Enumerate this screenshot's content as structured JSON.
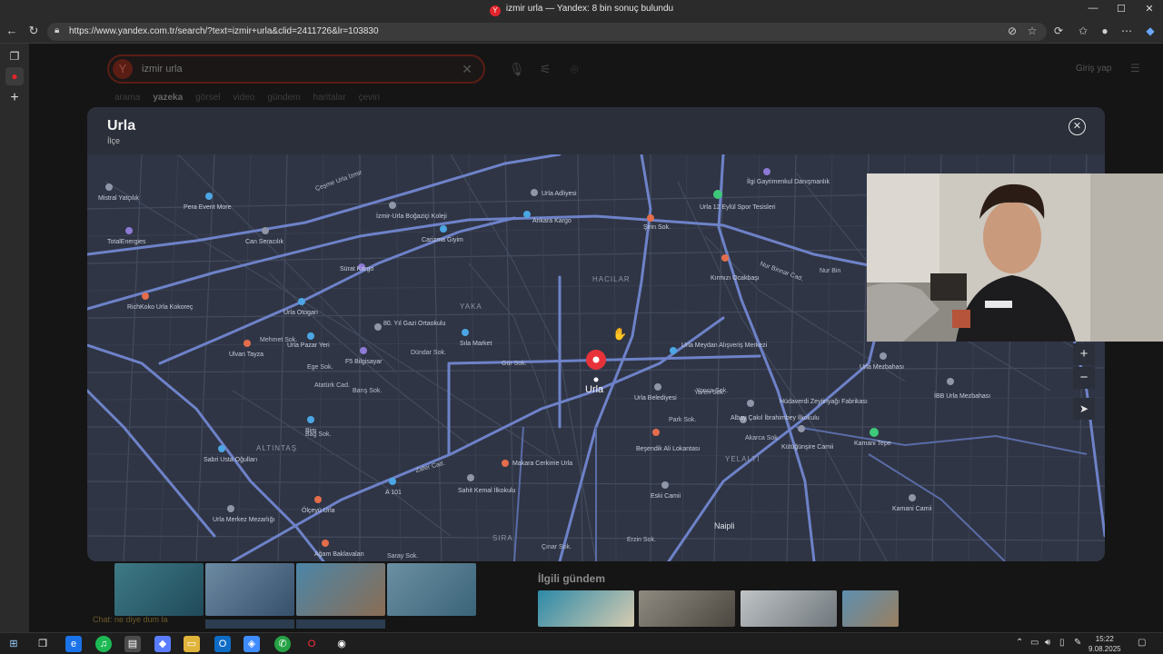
{
  "window": {
    "title": "izmir urla — Yandex: 8 bin sonuç bulundu",
    "minimize": "—",
    "maximize": "☐",
    "close": "✕"
  },
  "address_bar": {
    "url": "https://www.yandex.com.tr/search/?text=izmir+urla&clid=2411726&lr=103830"
  },
  "search": {
    "query": "izmir urla",
    "login_label": "Giriş yap",
    "tabs": [
      "arama",
      "yazeka",
      "görsel",
      "video",
      "gündem",
      "haritalar",
      "çeviri"
    ],
    "active_tab": "yazeka"
  },
  "modal": {
    "title": "Urla",
    "subtitle": "İlçe",
    "zoom_in": "+",
    "zoom_out": "−"
  },
  "map": {
    "center_label": "Urla",
    "districts": [
      "HACILAR",
      "YAKA",
      "ALTINTAŞ",
      "YELALTI",
      "SIRA"
    ],
    "roads": [
      "Çeşme Urla İzmir",
      "Nur Binnar Cad.",
      "Nur Bin",
      "Gür Sok.",
      "Zafer Cad.",
      "Atatürk Cad.",
      "Barış Sok.",
      "Dündar Sok.",
      "Ege Sok.",
      "Bağ Sok.",
      "Saray Sok.",
      "Çınar Sok.",
      "Yaren Sok.",
      "Park Sok.",
      "Erzin Sok.",
      "Naipli",
      "Mehmet Sok.",
      "Akarca Sok.",
      "Yonca Sok."
    ],
    "pois": [
      "Mistral Yatçılık",
      "Pera Event More",
      "TotalEnergies",
      "İzmir-Urla Boğaziçi Koleji",
      "Can Seracılık",
      "Carizma Giyim",
      "Urla Adliyesi",
      "Ankara Kargo",
      "Şirin Sok.",
      "Urla 12 Eylül Spor Tesisleri",
      "İlgi Gayrimenkul Danışmanlık",
      "Kırmızı Ocakbaşı",
      "Sürat Kargo",
      "RichKoko Urla Kokoreç",
      "Urla Otogarı",
      "80. Yıl Gazi Ortaokulu",
      "Urla Pazar Yeri",
      "F5 Bilgisayar",
      "Sıla Market",
      "Ulvan Tayza",
      "Urla Meydan Alışveriş Merkezi",
      "Urla Belediyesi",
      "Hüdaverdi Zeytinyağı Fabrikası",
      "Albay Çakıl İbrahimbey İlkokulu",
      "Kütüğünşire Camii",
      "Kamani Tepe",
      "Urla Mezbahası",
      "İBB Urla Mezbahası",
      "Bim",
      "Sabri Usta Oğulları",
      "Beşendik Ali Lokantası",
      "Makara Cerkime Urla",
      "A 101",
      "Sahit Kemal İlkokulu",
      "Eski Camii",
      "Kamani Camii",
      "Urla Merkez Mezarlığı",
      "Ölçeyü Urla",
      "Ağam Baklavaları"
    ],
    "pin_color": "#e8323a"
  },
  "page": {
    "gundem_title": "İlgili gündem",
    "chat_note": "Chat: ne diye dum la"
  },
  "taskbar": {
    "time": "15:22",
    "date": "9.08.2025"
  },
  "colors": {
    "map_bg": "#2f3544",
    "road_major": "#6e82c9",
    "road_minor": "#4a5266",
    "label": "#c9cede",
    "yandex_red": "#e0242b"
  }
}
